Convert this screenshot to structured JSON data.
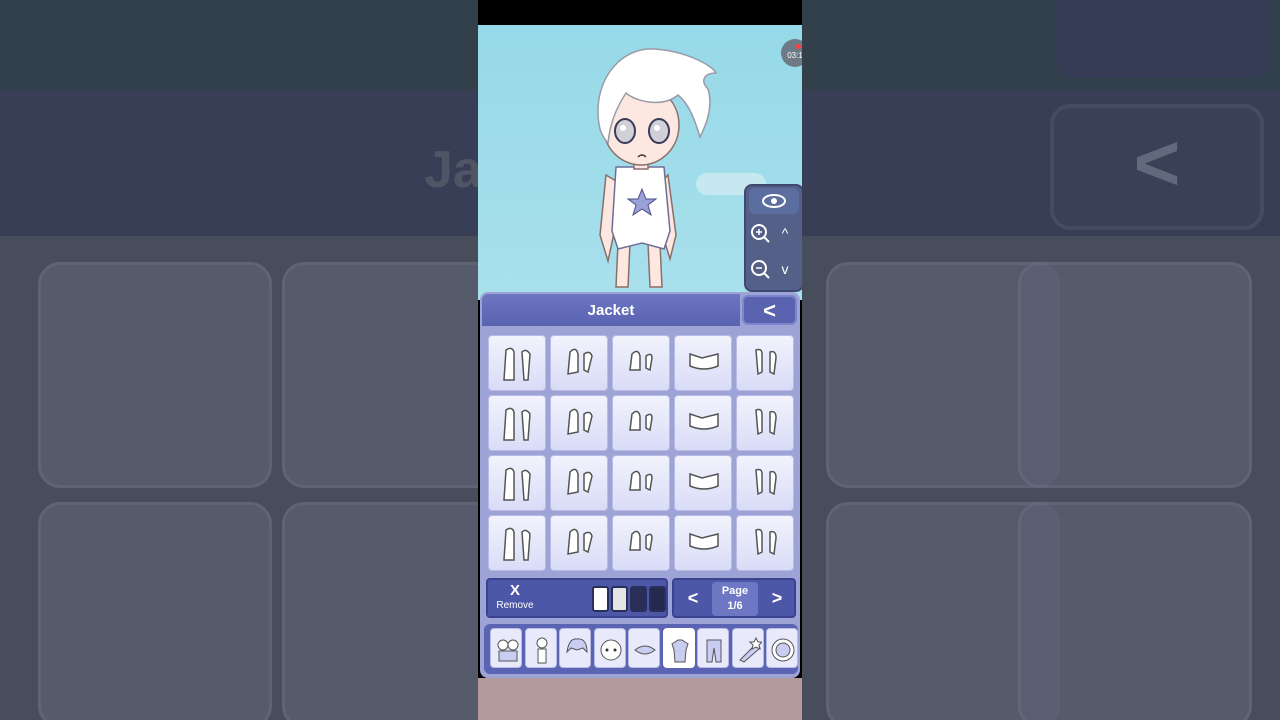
{
  "panel": {
    "title": "Jacket",
    "back_label": "<"
  },
  "items": {
    "rows": 4,
    "cols": 5
  },
  "controls": {
    "remove_symbol": "X",
    "remove_label": "Remove",
    "swatches": [
      "#ffffff",
      "#e4e4e4",
      "#2a2f5a",
      "#25294e"
    ]
  },
  "pager": {
    "prev": "<",
    "next": ">",
    "label": "Page",
    "value": "1/6"
  },
  "camera": {
    "zoom_in": "+",
    "zoom_out": "−",
    "up": "^",
    "down": "v"
  },
  "recorder": {
    "time": "03:1"
  },
  "tabs": [
    "presets",
    "body",
    "hair",
    "face",
    "accessories",
    "top",
    "bottom",
    "props",
    "profile"
  ],
  "background": {
    "title_fragment": "Ja",
    "back_symbol": "<"
  },
  "colors": {
    "header": "#5a63b0",
    "panel": "#9ea3d6",
    "sky": "#a9e0ec"
  }
}
